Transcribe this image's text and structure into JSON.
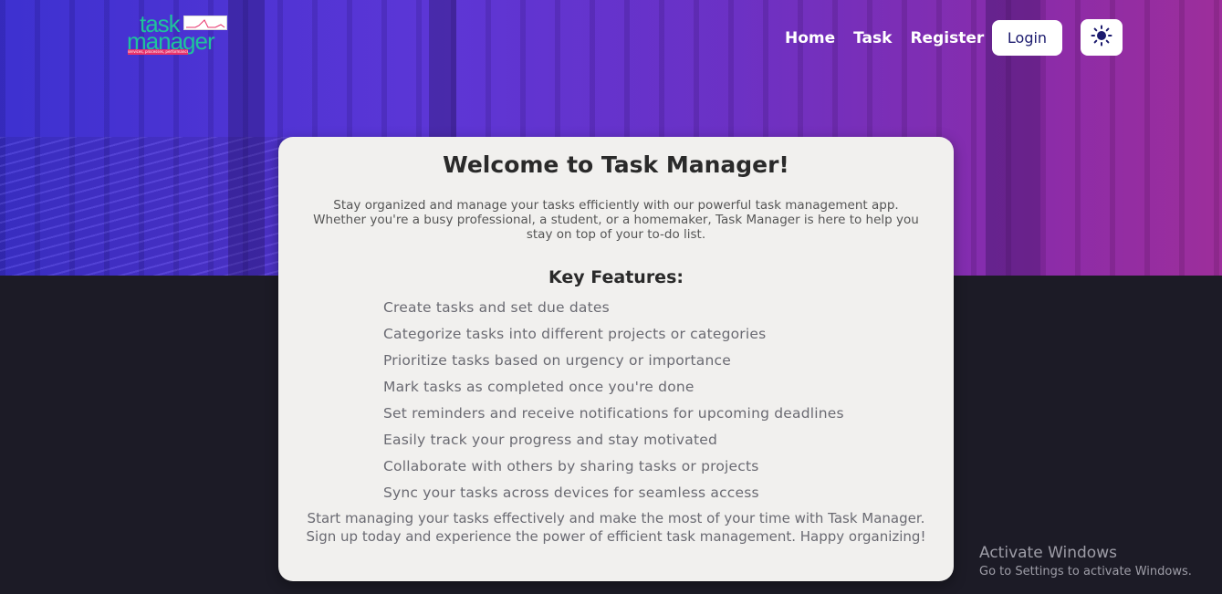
{
  "header": {
    "logo": {
      "line1": "task",
      "line2": "manager",
      "tagline": "services, processes, performance"
    },
    "nav": [
      {
        "label": "Home"
      },
      {
        "label": "Task"
      },
      {
        "label": "Register"
      }
    ],
    "login_label": "Login",
    "theme_icon": "sun-icon"
  },
  "card": {
    "title": "Welcome to Task Manager!",
    "intro": "Stay organized and manage your tasks efficiently with our powerful task management app. Whether you're a busy professional, a student, or a homemaker, Task Manager is here to help you stay on top of your to-do list.",
    "features_title": "Key Features:",
    "features": [
      "Create tasks and set due dates",
      "Categorize tasks into different projects or categories",
      "Prioritize tasks based on urgency or importance",
      "Mark tasks as completed once you're done",
      "Set reminders and receive notifications for upcoming deadlines",
      "Easily track your progress and stay motivated",
      "Collaborate with others by sharing tasks or projects",
      "Sync your tasks across devices for seamless access"
    ],
    "outro": "Start managing your tasks effectively and make the most of your time with Task Manager. Sign up today and experience the power of efficient task management. Happy organizing!"
  },
  "watermark": {
    "title": "Activate Windows",
    "subtitle": "Go to Settings to activate Windows."
  },
  "colors": {
    "accent": "#1c1b6e",
    "logo_green": "#1fc39b",
    "dark_bg": "#1c1b26"
  }
}
